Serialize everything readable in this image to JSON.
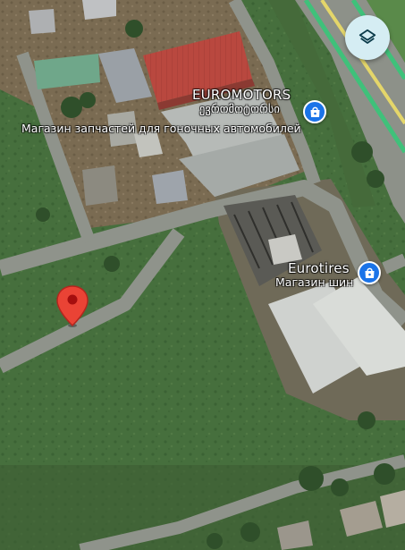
{
  "map": {
    "type": "satellite",
    "colors": {
      "grass": "#466f3d",
      "road": "#8a8f88",
      "highway_stripe_green": "#3fc17a",
      "highway_stripe_yellow": "#e4d66a",
      "poi_blue": "#1a73e8",
      "drop_pin_red": "#ea4335",
      "layers_button_bg": "#d5edf3"
    }
  },
  "places": [
    {
      "name": "EUROMOTORS",
      "name_local": "ევრომოტორსი",
      "category": "Магазин запчастей для гоночных автомобилей",
      "icon": "shopping-bag-icon"
    },
    {
      "name": "Eurotires",
      "category": "Магазин шин",
      "icon": "shopping-bag-icon"
    }
  ],
  "controls": {
    "layers_icon": "layers-icon"
  },
  "dropped_pin": {
    "icon": "map-pin-icon"
  }
}
